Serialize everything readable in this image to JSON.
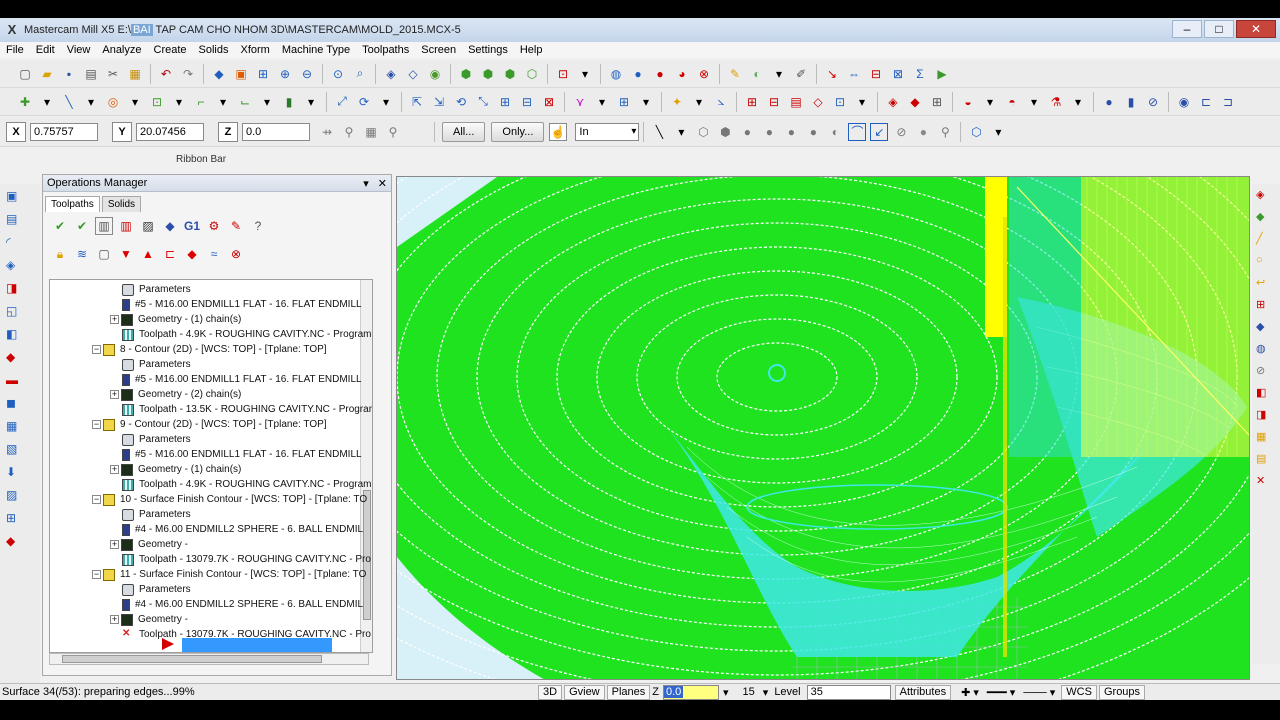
{
  "window": {
    "title_prefix": "Mastercam Mill X5 E:\\",
    "title_highlight": "BAI",
    "title_rest": " TAP CAM CHO NHOM 3D\\MASTERCAM\\MOLD_2015.MCX-5"
  },
  "menu": [
    "File",
    "Edit",
    "View",
    "Analyze",
    "Create",
    "Solids",
    "Xform",
    "Machine Type",
    "Toolpaths",
    "Screen",
    "Settings",
    "Help"
  ],
  "ribbon": {
    "x_label": "X",
    "x_value": "0.75757",
    "y_label": "Y",
    "y_value": "20.07456",
    "z_label": "Z",
    "z_value": "0.0",
    "all_button": "All...",
    "only_button": "Only...",
    "in_select": "In",
    "caption": "Ribbon Bar"
  },
  "ops_manager": {
    "title": "Operations Manager",
    "tabs": [
      "Toolpaths",
      "Solids"
    ],
    "tree": [
      {
        "text": "Parameters",
        "icon": "param"
      },
      {
        "text": "#5 - M16.00 ENDMILL1 FLAT -    16. FLAT ENDMILL",
        "icon": "tool"
      },
      {
        "text": "Geometry - (1) chain(s)",
        "icon": "geo"
      },
      {
        "text": "Toolpath - 4.9K - ROUGHING CAVITY.NC - Program",
        "icon": "path"
      },
      {
        "text": "8 - Contour (2D) - [WCS: TOP] - [Tplane: TOP]",
        "icon": "op"
      },
      {
        "text": "Parameters",
        "icon": "param"
      },
      {
        "text": "#5 - M16.00 ENDMILL1 FLAT -    16. FLAT ENDMILL",
        "icon": "tool"
      },
      {
        "text": "Geometry - (2) chain(s)",
        "icon": "geo"
      },
      {
        "text": "Toolpath - 13.5K - ROUGHING CAVITY.NC - Program",
        "icon": "path"
      },
      {
        "text": "9 - Contour (2D) - [WCS: TOP] - [Tplane: TOP]",
        "icon": "op"
      },
      {
        "text": "Parameters",
        "icon": "param"
      },
      {
        "text": "#5 - M16.00 ENDMILL1 FLAT -    16. FLAT ENDMILL",
        "icon": "tool"
      },
      {
        "text": "Geometry - (1) chain(s)",
        "icon": "geo"
      },
      {
        "text": "Toolpath - 4.9K - ROUGHING CAVITY.NC - Program",
        "icon": "path"
      },
      {
        "text": "10 - Surface Finish Contour - [WCS: TOP] - [Tplane: TO",
        "icon": "op"
      },
      {
        "text": "Parameters",
        "icon": "param"
      },
      {
        "text": "#4 - M6.00 ENDMILL2 SPHERE -    6. BALL ENDMIL",
        "icon": "tool"
      },
      {
        "text": "Geometry -",
        "icon": "geo"
      },
      {
        "text": "Toolpath - 13079.7K - ROUGHING CAVITY.NC - Pro",
        "icon": "path"
      },
      {
        "text": "11 - Surface Finish Contour - [WCS: TOP] - [Tplane: TO",
        "icon": "op"
      },
      {
        "text": "Parameters",
        "icon": "param"
      },
      {
        "text": "#4 - M6.00 ENDMILL2 SPHERE -    6. BALL ENDMIL",
        "icon": "tool"
      },
      {
        "text": "Geometry -",
        "icon": "geo"
      },
      {
        "text": "Toolpath - 13079.7K - ROUGHING CAVITY.NC - Pro",
        "icon": "dirty"
      }
    ]
  },
  "status": {
    "message": "Surface 34(/53): preparing edges...99%",
    "view3d": "3D",
    "gview": "Gview",
    "planes": "Planes",
    "z_label": "Z",
    "z_value": "0.0",
    "number": "15",
    "level_label": "Level",
    "level_value": "35",
    "attributes": "Attributes",
    "wcs": "WCS",
    "groups": "Groups"
  },
  "colors": {
    "surface_green": "#1fe31f",
    "toolpath_cyan": "#3fe8e8",
    "boundary_yellow": "#ffff00",
    "selection_blue": "#3399ff",
    "insert_arrow_red": "#d20000"
  }
}
